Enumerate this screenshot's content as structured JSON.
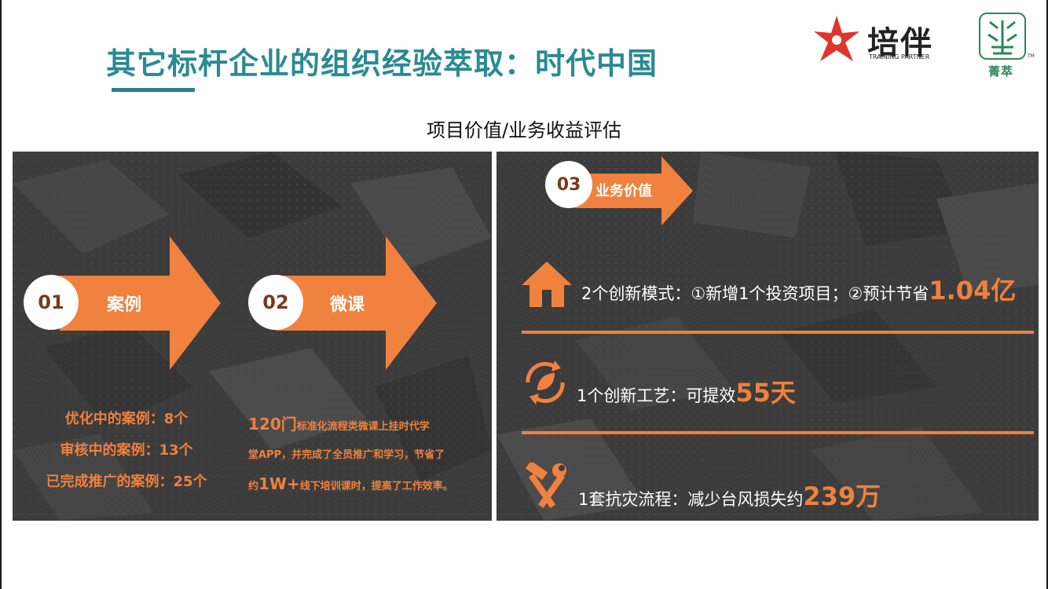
{
  "header": {
    "title": "其它标杆企业的组织经验萃取：时代中国",
    "subtitle": "项目价值/业务收益评估"
  },
  "logos": {
    "peiban_cn": "培伴",
    "peiban_en": "TRAINING PARTNER",
    "jingcui_cn": "菁萃",
    "jingcui_tm": "TM"
  },
  "colors": {
    "title": "#2a8a93",
    "accent_orange": "#f0813e",
    "panel_bg": "#3e3e3e",
    "logo_red": "#e0342c",
    "logo_green": "#2a8a55"
  },
  "left_panel": {
    "case": {
      "num": "01",
      "label": "案例"
    },
    "micro": {
      "num": "02",
      "label": "微课"
    },
    "case_stats": [
      "优化中的案例：8个",
      "审核中的案例：13个",
      "已完成推广的案例：25个"
    ],
    "micro_text": {
      "count": "120门",
      "line1_rest": "标准化流程类微课上挂时代学",
      "line2": "堂APP，并完成了全员推广和学习，节省了",
      "line3_pre": "约",
      "line3_big": "1W+",
      "line3_rest": "线下培训课时，提高了工作效率。"
    }
  },
  "right_panel": {
    "badge": {
      "num": "03",
      "label": "业务价值"
    },
    "rows": [
      {
        "icon": "house-icon",
        "text": "2个创新模式：①新增1个投资项目；②预计节省",
        "highlight": "1.04亿"
      },
      {
        "icon": "leaf-cycle-icon",
        "text": "1个创新工艺：可提效",
        "highlight": "55天"
      },
      {
        "icon": "hammer-wrench-icon",
        "text": "1套抗灾流程：减少台风损失约",
        "highlight": "239万"
      }
    ]
  }
}
